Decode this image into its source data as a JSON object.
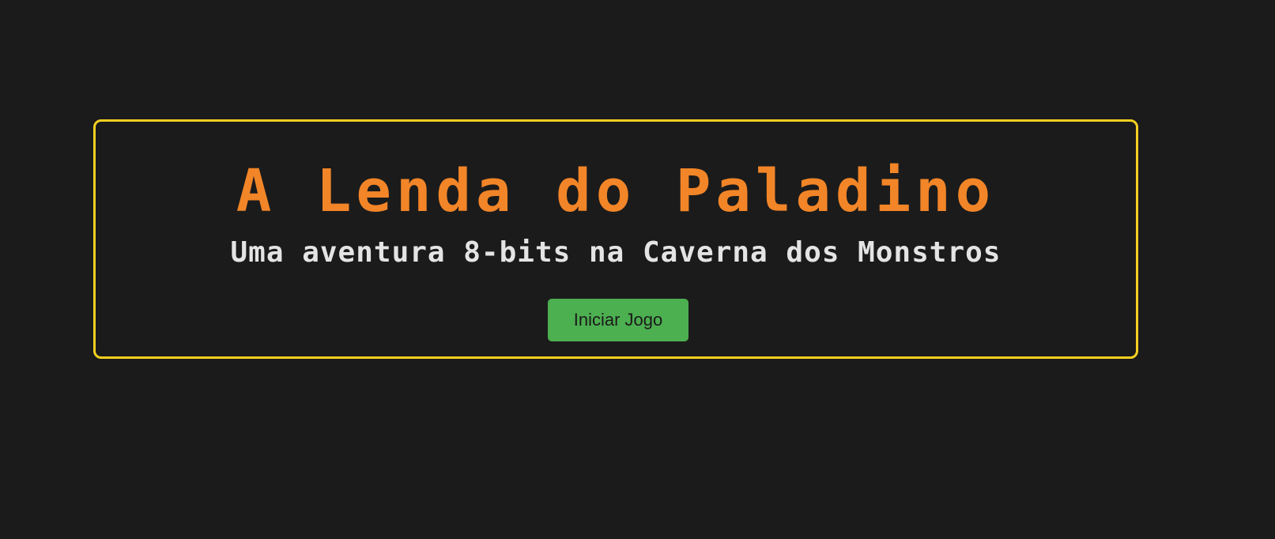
{
  "game": {
    "title": "A Lenda do Paladino",
    "subtitle": "Uma aventura 8-bits na Caverna dos Monstros",
    "start_button_label": "Iniciar Jogo"
  },
  "colors": {
    "background": "#1b1b1b",
    "border": "#f5d020",
    "title": "#f28528",
    "subtitle": "#e4e4e4",
    "button": "#4caf50"
  }
}
